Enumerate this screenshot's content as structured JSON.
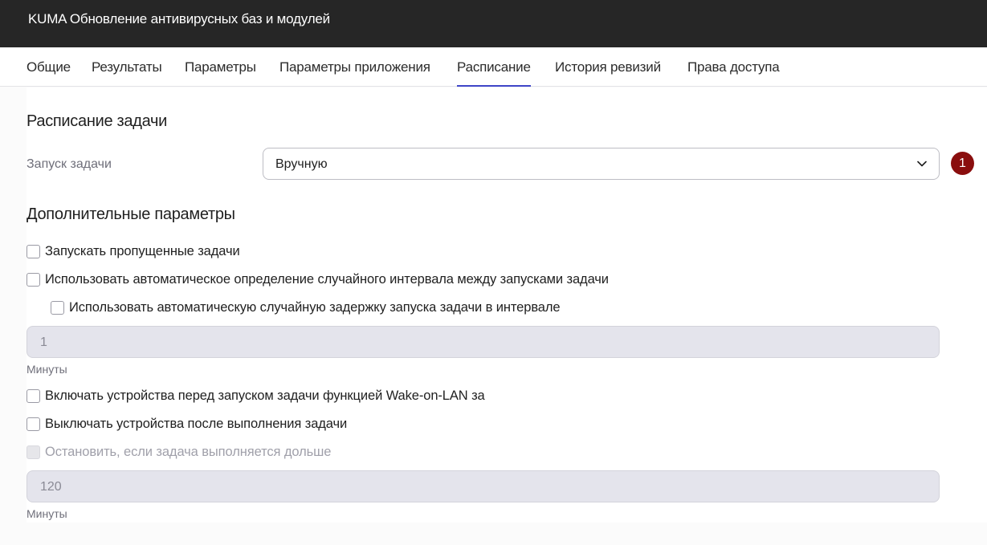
{
  "header": {
    "title": "KUMA Обновление антивирусных баз и модулей"
  },
  "tabs": [
    {
      "label": "Общие"
    },
    {
      "label": "Результаты"
    },
    {
      "label": "Параметры"
    },
    {
      "label": "Параметры приложения"
    },
    {
      "label": "Расписание",
      "active": true
    },
    {
      "label": "История ревизий"
    },
    {
      "label": "Права доступа"
    }
  ],
  "schedule": {
    "heading": "Расписание задачи",
    "run_label": "Запуск задачи",
    "run_value": "Вручную",
    "badge": "1"
  },
  "advanced": {
    "heading": "Дополнительные параметры",
    "options": [
      {
        "label": "Запускать пропущенные задачи",
        "checked": false
      },
      {
        "label": "Использовать автоматическое определение случайного интервала между запусками задачи",
        "checked": false
      },
      {
        "label": "Использовать автоматическую случайную задержку запуска задачи в интервале",
        "checked": false
      },
      {
        "label": "Включать устройства перед запуском задачи функцией Wake-on-LAN за",
        "checked": false
      },
      {
        "label": "Выключать устройства после выполнения задачи",
        "checked": false
      },
      {
        "label": "Остановить, если задача выполняется дольше",
        "checked": false,
        "disabled": true
      }
    ],
    "delay_value": "1",
    "delay_unit": "Минуты",
    "stop_value": "120",
    "stop_unit": "Минуты"
  },
  "colors": {
    "header_bg": "#262626",
    "active_tab_underline": "#3f46c8",
    "badge_bg": "#8a0e0e"
  },
  "icons": {
    "select_arrow": "chevron-down-icon"
  }
}
